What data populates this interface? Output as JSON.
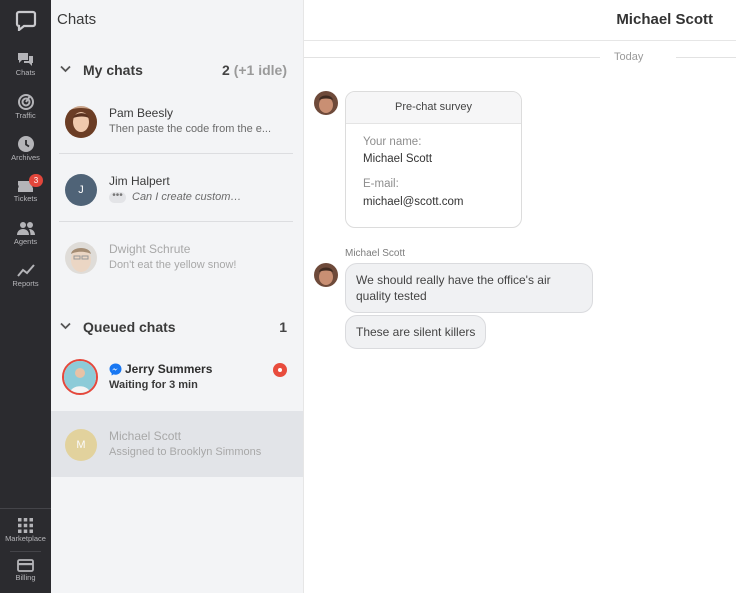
{
  "rail": {
    "items": [
      {
        "label": "Chats",
        "icon": "chats-icon"
      },
      {
        "label": "Traffic",
        "icon": "traffic-icon"
      },
      {
        "label": "Archives",
        "icon": "archives-icon"
      },
      {
        "label": "Tickets",
        "icon": "tickets-icon",
        "badge": "3"
      },
      {
        "label": "Agents",
        "icon": "agents-icon"
      },
      {
        "label": "Reports",
        "icon": "reports-icon"
      }
    ],
    "bottom": [
      {
        "label": "Marketplace",
        "icon": "marketplace-icon"
      },
      {
        "label": "Billing",
        "icon": "billing-icon"
      }
    ]
  },
  "list": {
    "title": "Chats",
    "my_chats": {
      "label": "My chats",
      "count": "2",
      "idle": "(+1 idle)",
      "items": [
        {
          "name": "Pam Beesly",
          "message": "Then paste the code from the e..."
        },
        {
          "name": "Jim Halpert",
          "initial": "J",
          "message": "Can I create custom…"
        },
        {
          "name": "Dwight Schrute",
          "message": "Don't eat the yellow snow!"
        }
      ]
    },
    "queued": {
      "label": "Queued chats",
      "count": "1",
      "items": [
        {
          "name": "Jerry Summers",
          "message": "Waiting for 3 min"
        },
        {
          "name": "Michael Scott",
          "initial": "M",
          "message": "Assigned to Brooklyn Simmons"
        }
      ]
    }
  },
  "main": {
    "title": "Michael Scott",
    "day_label": "Today",
    "survey": {
      "title": "Pre-chat survey",
      "name_label": "Your name:",
      "name_value": "Michael Scott",
      "email_label": "E-mail:",
      "email_value": "michael@scott.com"
    },
    "sender": "Michael Scott",
    "messages": [
      "We should really have the office's air quality tested",
      "These are silent killers"
    ]
  },
  "colors": {
    "rail_bg": "#2b2b2f",
    "list_bg": "#f3f4f6",
    "badge_red": "#e2463b",
    "messenger_blue": "#1877f2"
  }
}
